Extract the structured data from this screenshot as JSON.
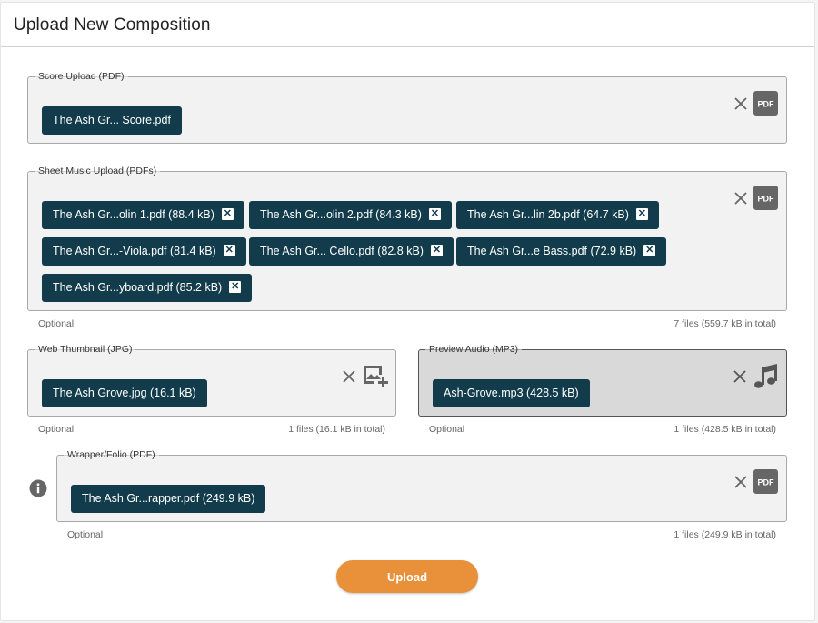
{
  "page": {
    "title": "Upload New Composition"
  },
  "colors": {
    "chip": "#123c4b",
    "accent": "#e8913a",
    "field_bg": "#f2f2f2",
    "active_bg": "#d9d9d9"
  },
  "score": {
    "label": "Score Upload (PDF)",
    "files": [
      {
        "name": "The Ash Gr... Score.pdf"
      }
    ],
    "icon": "pdf-icon"
  },
  "sheet_music": {
    "label": "Sheet Music Upload (PDFs)",
    "files": [
      {
        "name": "The Ash Gr...olin 1.pdf (88.4 kB)"
      },
      {
        "name": "The Ash Gr...olin 2.pdf (84.3 kB)"
      },
      {
        "name": "The Ash Gr...lin 2b.pdf (64.7 kB)"
      },
      {
        "name": "The Ash Gr...-Viola.pdf (81.4 kB)"
      },
      {
        "name": "The Ash Gr... Cello.pdf (82.8 kB)"
      },
      {
        "name": "The Ash Gr...e Bass.pdf (72.9 kB)"
      },
      {
        "name": "The Ash Gr...yboard.pdf (85.2 kB)"
      }
    ],
    "optional": "Optional",
    "summary": "7 files (559.7 kB in total)",
    "icon": "pdf-icon"
  },
  "thumbnail": {
    "label": "Web Thumbnail (JPG)",
    "files": [
      {
        "name": "The Ash Grove.jpg (16.1 kB)"
      }
    ],
    "optional": "Optional",
    "summary": "1 files (16.1 kB in total)",
    "icon": "add-image-icon"
  },
  "audio": {
    "label": "Preview Audio (MP3)",
    "files": [
      {
        "name": "Ash-Grove.mp3 (428.5 kB)"
      }
    ],
    "optional": "Optional",
    "summary": "1 files (428.5 kB in total)",
    "icon": "music-note-icon"
  },
  "wrapper": {
    "label": "Wrapper/Folio (PDF)",
    "files": [
      {
        "name": "The Ash Gr...rapper.pdf (249.9 kB)"
      }
    ],
    "optional": "Optional",
    "summary": "1 files (249.9 kB in total)",
    "icon": "pdf-icon"
  },
  "icons": {
    "pdf_text": "PDF",
    "chip_remove": "✕"
  },
  "actions": {
    "upload_label": "Upload"
  }
}
